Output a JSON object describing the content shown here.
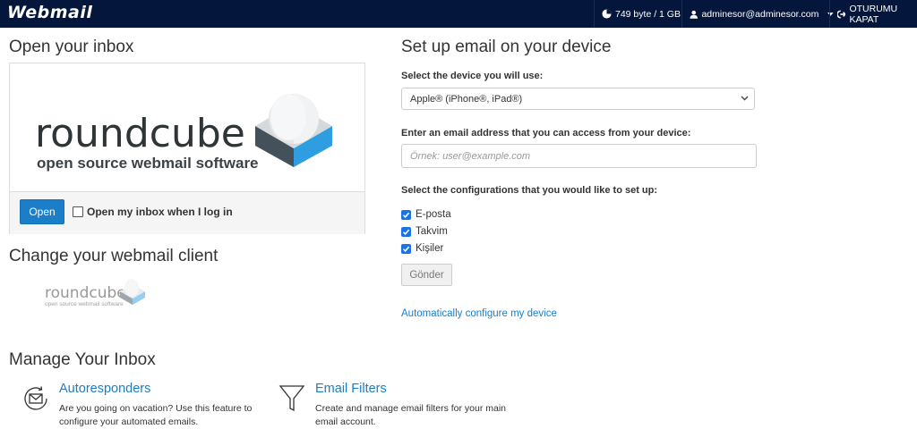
{
  "topbar": {
    "brand": "Webmail",
    "disk_usage": "749 byte / 1 GB",
    "user": "adminesor@adminesor.com",
    "logout": "OTURUMU KAPAT",
    "icons": {
      "disk": "pie-chart-icon",
      "user": "user-icon",
      "logout": "logout-icon"
    }
  },
  "inbox": {
    "heading": "Open your inbox",
    "logo_word": "roundcube",
    "logo_tagline": "open source webmail software",
    "open_button": "Open",
    "auto_open_label": "Open my inbox when I log in",
    "auto_open_checked": false
  },
  "change_client": {
    "heading": "Change your webmail client",
    "logo_word": "roundcube",
    "logo_tagline": "open source webmail software"
  },
  "setup": {
    "heading": "Set up email on your device",
    "device_label": "Select the device you will use:",
    "device_value": "Apple® (iPhone®, iPad®)",
    "email_label": "Enter an email address that you can access from your device:",
    "email_placeholder": "Örnek: user@example.com",
    "config_label": "Select the configurations that you would like to set up:",
    "options": [
      {
        "label": "E-posta",
        "checked": true
      },
      {
        "label": "Takvim",
        "checked": true
      },
      {
        "label": "Kişiler",
        "checked": true
      }
    ],
    "send_button": "Gönder",
    "auto_link": "Automatically configure my device"
  },
  "manage": {
    "heading": "Manage Your Inbox",
    "items": [
      {
        "title": "Autoresponders",
        "description": "Are you going on vacation? Use this feature to configure your automated emails.",
        "icon": "mail-clock-icon"
      },
      {
        "title": "Email Filters",
        "description": "Create and manage email filters for your main email account.",
        "icon": "filter-icon"
      }
    ]
  },
  "colors": {
    "topbar": "#04163c",
    "accent": "#1a7ec8",
    "checkbox": "#1a73e8"
  }
}
